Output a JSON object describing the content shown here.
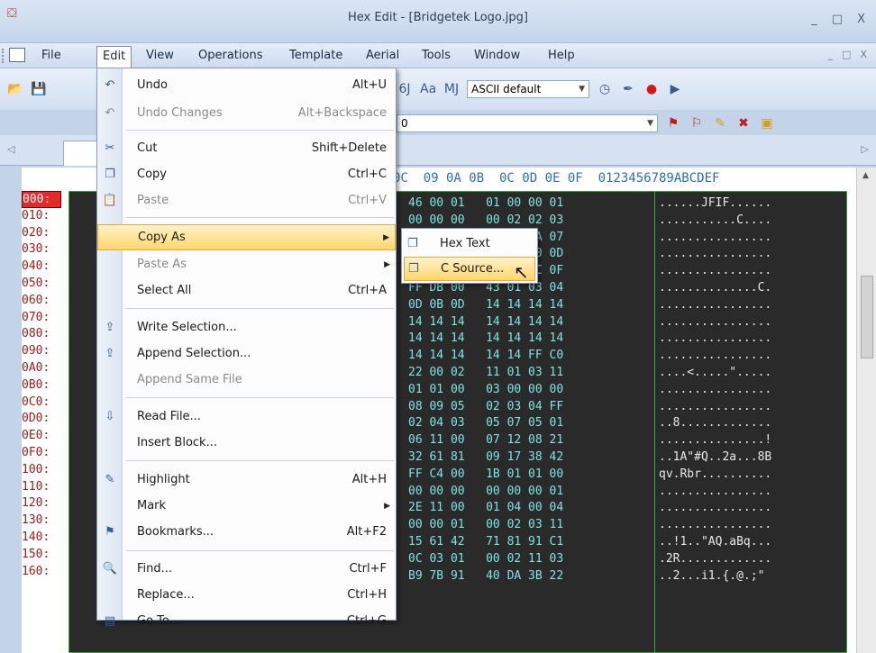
{
  "window": {
    "title": "Hex Edit - [Bridgetek Logo.jpg]",
    "controls": [
      "_",
      "□",
      "X"
    ]
  },
  "menubar": {
    "items": [
      "File",
      "Edit",
      "View",
      "Operations",
      "Template",
      "Aerial",
      "Tools",
      "Window",
      "Help"
    ],
    "mdi_controls": [
      "_",
      "□",
      "X"
    ]
  },
  "toolbar": {
    "char_set": "ASCII default",
    "goto_value": "0"
  },
  "hex": {
    "header": "0C  09 0A 0B  0C 0D 0E 0F  0123456789ABCDEF",
    "addresses": [
      "000:",
      "010:",
      "020:",
      "030:",
      "040:",
      "050:",
      "060:",
      "070:",
      "080:",
      "090:",
      "0A0:",
      "0B0:",
      "0C0:",
      "0D0:",
      "0E0:",
      "0F0:",
      "100:",
      "110:",
      "120:",
      "130:",
      "140:",
      "150:",
      "160:"
    ],
    "rows": [
      "46 00 01   01 00 00 01",
      "00 00 00   00 02 02 03",
      "05 05 05   05 05 0A 07",
      "0C 0C 0C   0C 12 10 0D",
      "13 14 15   15 15 0C 0F",
      "FF DB 00   43 01 03 04",
      "0D 0B 0D   14 14 14 14",
      "14 14 14   14 14 14 14",
      "14 14 14   14 14 14 14",
      "14 14 14   14 14 FF C0",
      "22 00 02   11 01 03 11",
      "01 01 00   03 00 00 00",
      "08 09 05   02 03 04 FF",
      "02 04 03   05 07 05 01",
      "06 11 00   07 12 08 21",
      "32 61 81   09 17 38 42",
      "FF C4 00   1B 01 01 00",
      "00 00 00   00 00 00 01",
      "2E 11 00   01 04 00 04",
      "00 00 01   00 02 03 11",
      "15 61 42   71 81 91 C1",
      "0C 03 01   00 02 11 03",
      "B9 7B 91   40 DA 3B 22"
    ],
    "ascii": [
      "......JFIF......",
      "...........C....",
      "................",
      "................",
      "................",
      "..............C.",
      "................",
      "................",
      "................",
      "................",
      "....<.....\".....",
      "................",
      "................",
      "..8.............",
      "...............!",
      "..1A\"#Q..2a...8B",
      "qv.Rbr..........",
      "................",
      "................",
      "................",
      "..!1..\"AQ.aBq...",
      ".2R.............",
      "..2...i1.{.@.;\""
    ]
  },
  "edit_menu": {
    "items": [
      {
        "icon": "undo-icon",
        "glyph": "↶",
        "label": "Undo",
        "shortcut": "Alt+U",
        "disabled": false
      },
      {
        "icon": "undo-changes-icon",
        "glyph": "↶",
        "label": "Undo Changes",
        "shortcut": "Alt+Backspace",
        "disabled": true
      },
      {
        "icon": "cut-icon",
        "glyph": "✂",
        "label": "Cut",
        "shortcut": "Shift+Delete",
        "disabled": false
      },
      {
        "icon": "copy-icon",
        "glyph": "❐",
        "label": "Copy",
        "shortcut": "Ctrl+C",
        "disabled": false
      },
      {
        "icon": "paste-icon",
        "glyph": "📋",
        "label": "Paste",
        "shortcut": "Ctrl+V",
        "disabled": true
      },
      {
        "icon": "",
        "glyph": "",
        "label": "Copy As",
        "shortcut": "",
        "disabled": false
      },
      {
        "icon": "",
        "glyph": "",
        "label": "Paste As",
        "shortcut": "",
        "disabled": true
      },
      {
        "icon": "",
        "glyph": "",
        "label": "Select All",
        "shortcut": "Ctrl+A",
        "disabled": false
      },
      {
        "icon": "write-selection-icon",
        "glyph": "⇪",
        "label": "Write Selection...",
        "shortcut": "",
        "disabled": false
      },
      {
        "icon": "append-selection-icon",
        "glyph": "⇪",
        "label": "Append Selection...",
        "shortcut": "",
        "disabled": false
      },
      {
        "icon": "",
        "glyph": "",
        "label": "Append Same File",
        "shortcut": "",
        "disabled": true
      },
      {
        "icon": "read-file-icon",
        "glyph": "⇩",
        "label": "Read File...",
        "shortcut": "",
        "disabled": false
      },
      {
        "icon": "",
        "glyph": "",
        "label": "Insert Block...",
        "shortcut": "",
        "disabled": false
      },
      {
        "icon": "highlight-icon",
        "glyph": "✎",
        "label": "Highlight",
        "shortcut": "Alt+H",
        "disabled": false
      },
      {
        "icon": "",
        "glyph": "",
        "label": "Mark",
        "shortcut": "",
        "disabled": false
      },
      {
        "icon": "bookmarks-icon",
        "glyph": "⚑",
        "label": "Bookmarks...",
        "shortcut": "Alt+F2",
        "disabled": false
      },
      {
        "icon": "find-icon",
        "glyph": "🔍",
        "label": "Find...",
        "shortcut": "Ctrl+F",
        "disabled": false
      },
      {
        "icon": "",
        "glyph": "",
        "label": "Replace...",
        "shortcut": "Ctrl+H",
        "disabled": false
      },
      {
        "icon": "goto-icon",
        "glyph": "▤",
        "label": "Go To...",
        "shortcut": "Ctrl+G",
        "disabled": false
      }
    ]
  },
  "copy_as_submenu": {
    "items": [
      "Hex Text",
      "C Source..."
    ]
  }
}
